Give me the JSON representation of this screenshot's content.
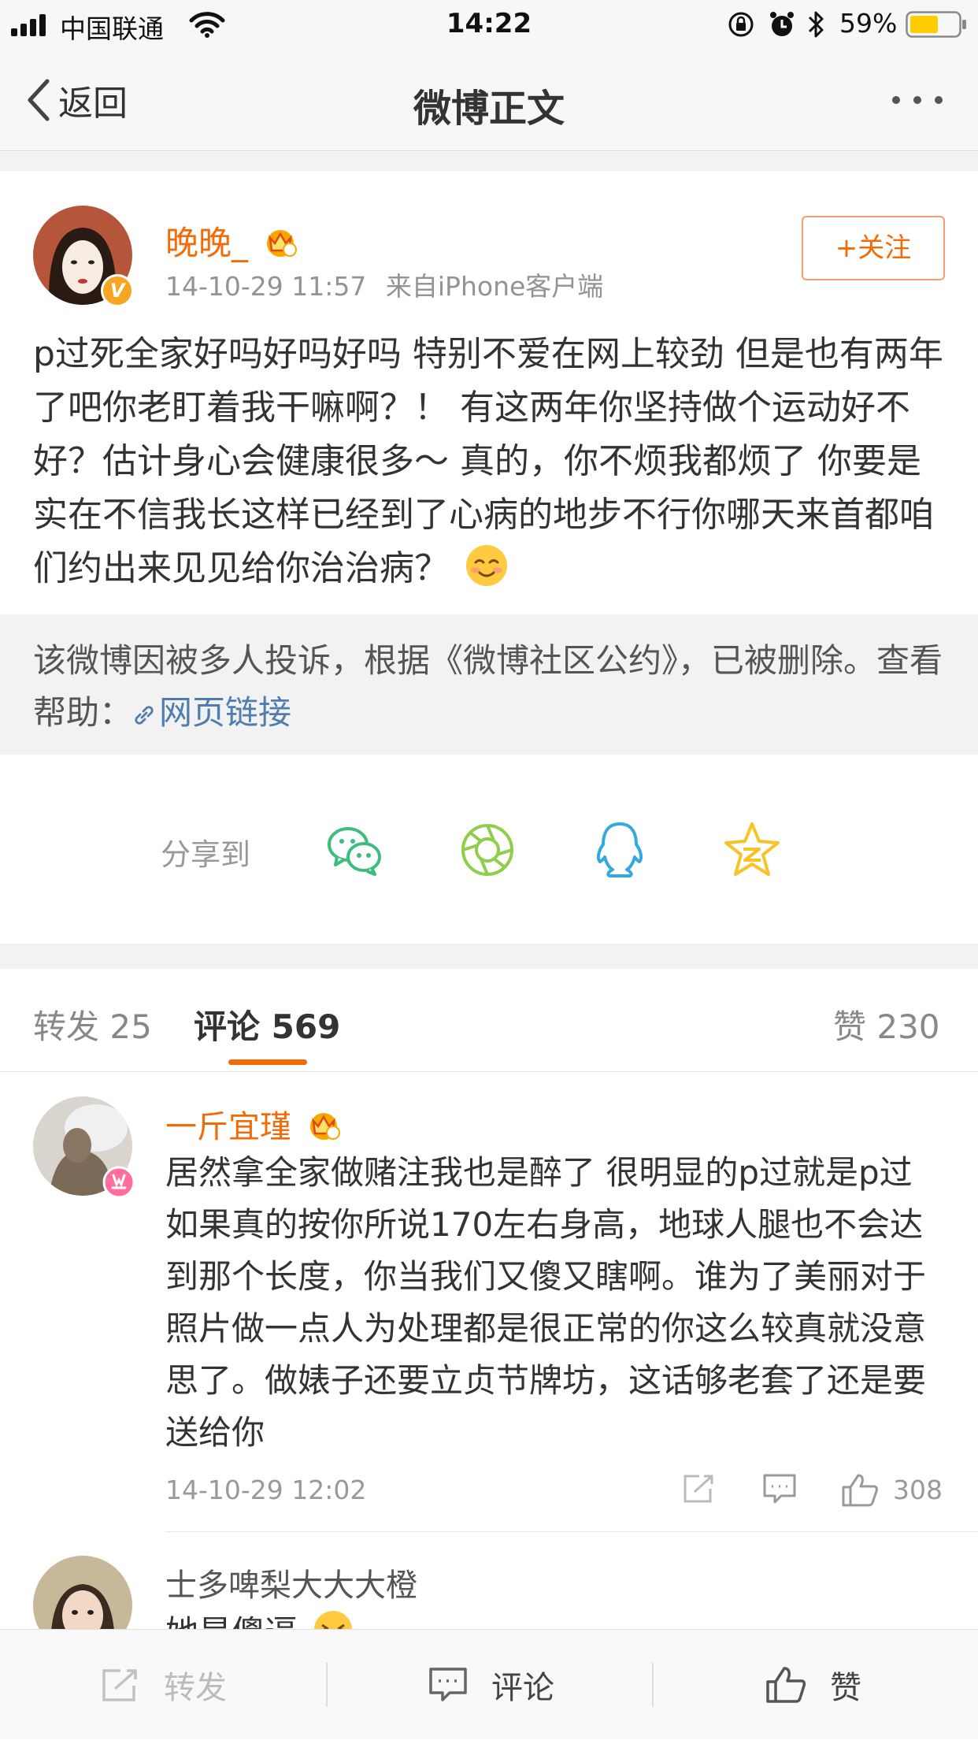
{
  "status_bar": {
    "carrier": "中国联通",
    "time": "14:22",
    "battery_percent": "59%",
    "battery_level": 0.59
  },
  "nav": {
    "back_label": "返回",
    "title": "微博正文"
  },
  "post": {
    "author": "晚晚_",
    "timestamp": "14-10-29 11:57",
    "source": "来自iPhone客户端",
    "follow_label": "+关注",
    "verified_mark": "V",
    "body": "p过死全家好吗好吗好吗 特别不爱在网上较劲 但是也有两年了吧你老盯着我干嘛啊？！ 有这两年你坚持做个运动好不好？估计身心会健康很多～ 真的，你不烦我都烦了 你要是实在不信我长这样已经到了心病的地步不行你哪天来首都咱们约出来见见给你治治病？",
    "emoji": "smile-emoji"
  },
  "deleted_notice": {
    "text": "该微博因被多人投诉，根据《微博社区公约》，已被删除。查看帮助：",
    "link_label": "网页链接"
  },
  "share": {
    "label": "分享到",
    "targets": [
      "wechat-icon",
      "moments-icon",
      "qq-icon",
      "qzone-icon"
    ]
  },
  "tabs": {
    "repost": "转发 25",
    "comments": "评论 569",
    "likes": "赞 230"
  },
  "comments": [
    {
      "author": "一斤宜瑾",
      "text": "居然拿全家做赌注我也是醉了 很明显的p过就是p过 如果真的按你所说170左右身高，地球人腿也不会达到那个长度，你当我们又傻又瞎啊。谁为了美丽对于照片做一点人为处理都是很正常的你这么较真就没意思了。做婊子还要立贞节牌坊，这话够老套了还是要送给你",
      "time": "14-10-29 12:02",
      "likes": "308"
    },
    {
      "author": "士多啤梨大大大橙",
      "text": "她是傻逼"
    }
  ],
  "toolbar": {
    "repost": "转发",
    "comment": "评论",
    "like": "赞"
  },
  "colors": {
    "accent": "#f26b07",
    "link": "#507daf",
    "wechat": "#3dbd7d",
    "moments": "#8fce4a",
    "qq": "#34a8e0",
    "qzone": "#f7c326"
  }
}
